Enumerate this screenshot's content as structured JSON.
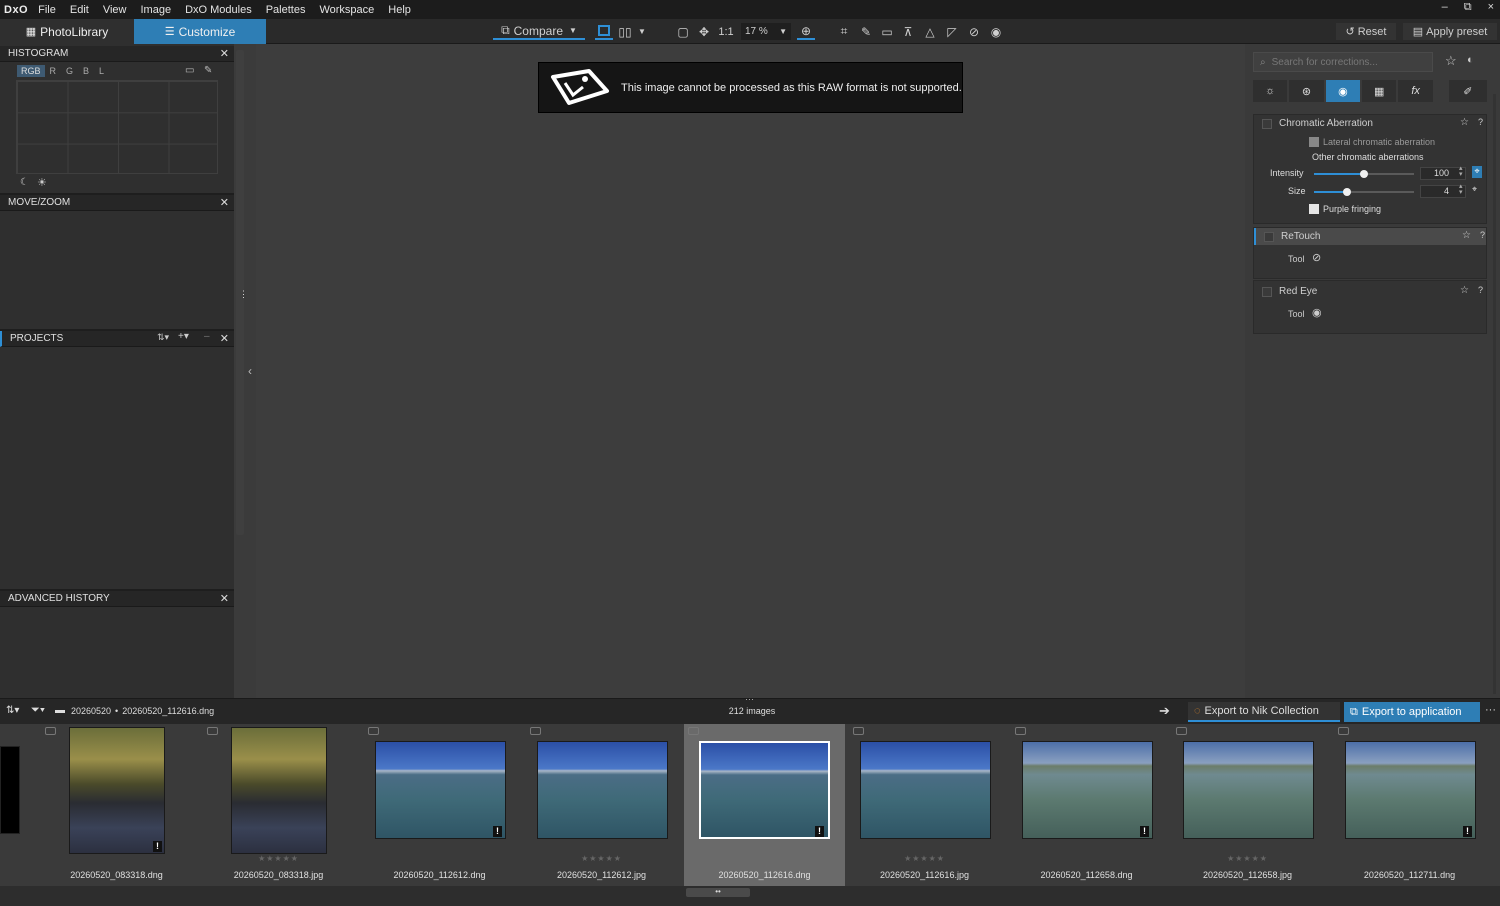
{
  "menu": {
    "logo": "DxO",
    "items": [
      "File",
      "Edit",
      "View",
      "Image",
      "DxO Modules",
      "Palettes",
      "Workspace",
      "Help"
    ]
  },
  "window_controls": [
    "–",
    "⧉",
    "×"
  ],
  "tabs": {
    "library": "PhotoLibrary",
    "customize": "Customize"
  },
  "toolbar": {
    "compare": "Compare",
    "one_to_one": "1:1",
    "zoom": "17 %",
    "reset": "Reset",
    "apply_preset": "Apply preset"
  },
  "left": {
    "histogram": {
      "title": "HISTOGRAM",
      "channels": [
        "RGB",
        "R",
        "G",
        "B",
        "L"
      ]
    },
    "move_zoom": {
      "title": "MOVE/ZOOM"
    },
    "projects": {
      "title": "PROJECTS"
    },
    "history": {
      "title": "ADVANCED HISTORY"
    }
  },
  "toast": {
    "message": "This image cannot be processed as this RAW format is not supported."
  },
  "right": {
    "search_placeholder": "Search for corrections...",
    "chromatic": {
      "title": "Chromatic Aberration",
      "lateral": "Lateral chromatic aberration",
      "other": "Other chromatic aberrations",
      "intensity_label": "Intensity",
      "intensity": "100",
      "intensity_frac": 0.5,
      "size_label": "Size",
      "size": "4",
      "size_frac": 0.33,
      "purple": "Purple fringing"
    },
    "retouch": {
      "title": "ReTouch",
      "tool": "Tool"
    },
    "redeye": {
      "title": "Red Eye",
      "tool": "Tool"
    }
  },
  "filmstrip": {
    "breadcrumb_folder": "20260520",
    "breadcrumb_file": "20260520_112616.dng",
    "sep": "•",
    "count": "212 images",
    "export_nik": "Export to Nik Collection",
    "export_app": "Export to application",
    "items": [
      {
        "name": "20260520_083318.dng"
      },
      {
        "name": "20260520_083318.jpg"
      },
      {
        "name": "20260520_112612.dng"
      },
      {
        "name": "20260520_112612.jpg"
      },
      {
        "name": "20260520_112616.dng"
      },
      {
        "name": "20260520_112616.jpg"
      },
      {
        "name": "20260520_112658.dng"
      },
      {
        "name": "20260520_112658.jpg"
      },
      {
        "name": "20260520_112711.dng"
      }
    ]
  },
  "colors": {
    "accent": "#2e8fd6",
    "tab_active": "#2e7eb5"
  }
}
